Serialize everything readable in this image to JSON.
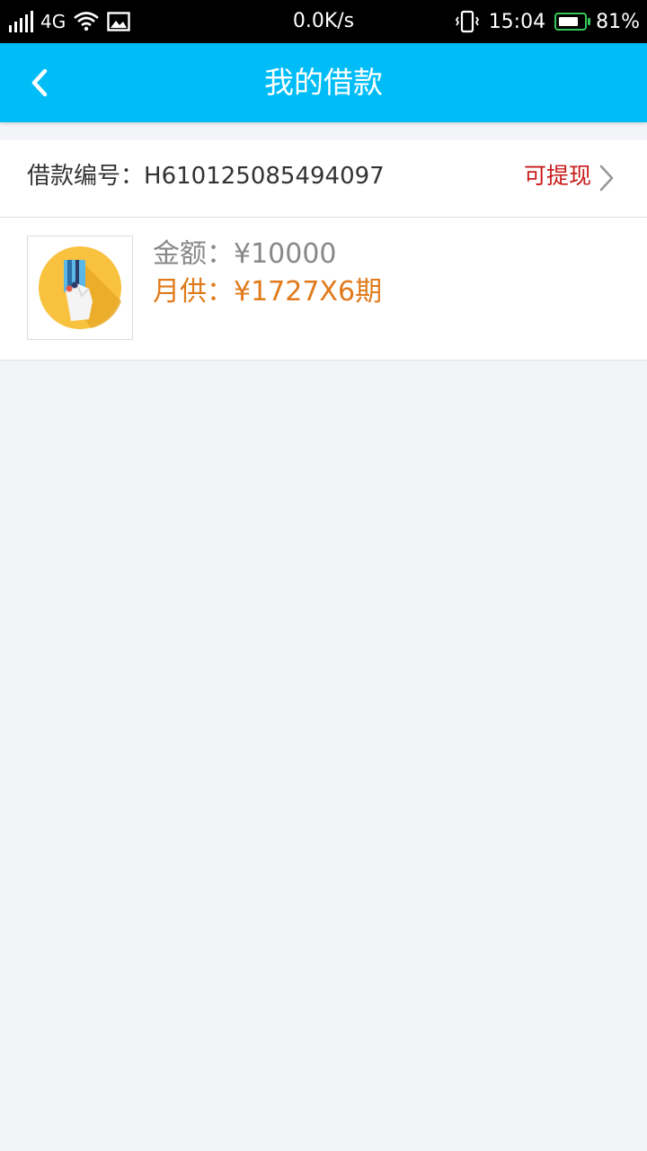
{
  "status_bar": {
    "network": "4G",
    "speed": "0.0K/s",
    "time": "15:04",
    "battery": "81%",
    "battery_level": 0.81,
    "icons": [
      "signal-icon",
      "wifi-icon",
      "image-icon",
      "vibrate-icon",
      "battery-icon"
    ]
  },
  "header": {
    "title": "我的借款",
    "back_icon": "chevron-left-icon",
    "background": "#00bdf7"
  },
  "loan": {
    "number_label": "借款编号：",
    "number": "H610125085494097",
    "status": "可提现",
    "status_color": "#c81a1a",
    "amount_label": "金额：",
    "amount": "¥10000",
    "monthly_label": "月供：",
    "monthly": "¥1727X6期",
    "monthly_color": "#e07a1a",
    "thumbnail_icon": "credit-card-hand-icon"
  }
}
